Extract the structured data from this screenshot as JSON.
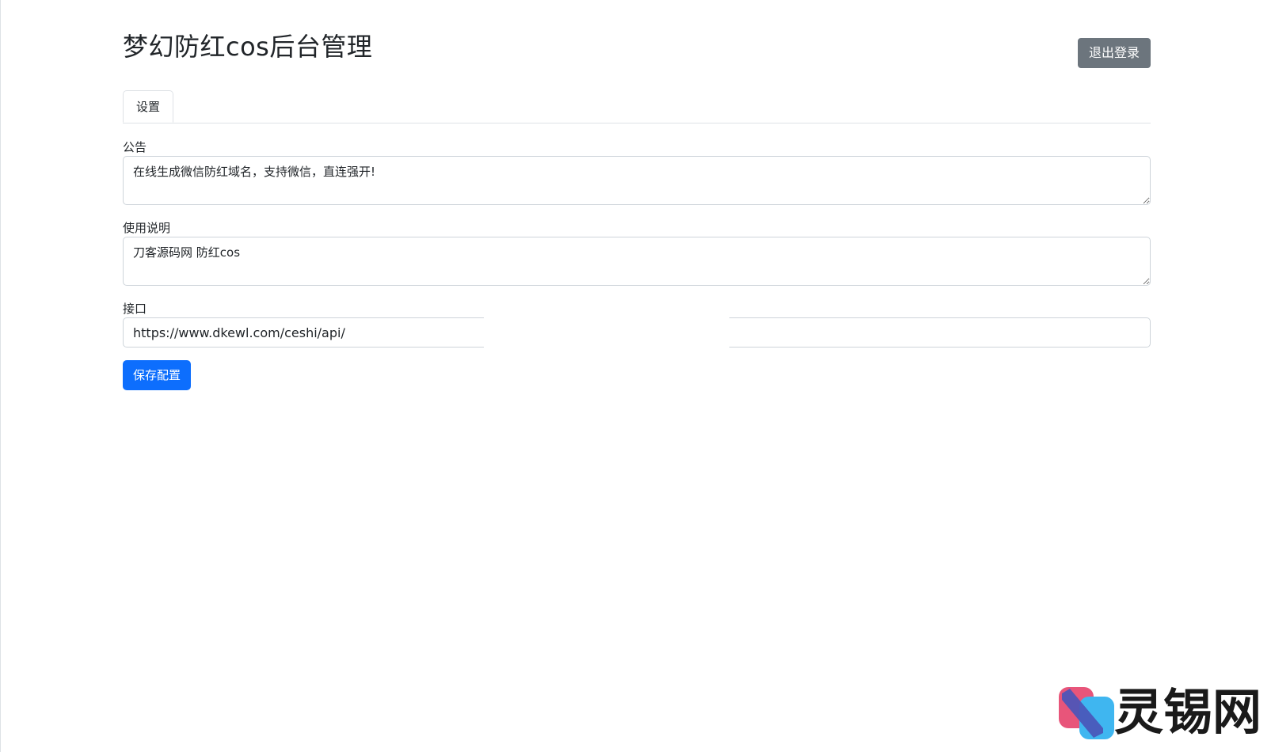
{
  "header": {
    "title": "梦幻防红cos后台管理",
    "logout_label": "退出登录"
  },
  "tabs": [
    {
      "label": "设置",
      "active": true
    }
  ],
  "form": {
    "notice": {
      "label": "公告",
      "value": "在线生成微信防红域名，支持微信，直连强开!"
    },
    "instructions": {
      "label": "使用说明",
      "value": "刀客源码网 防红cos"
    },
    "api": {
      "label": "接口",
      "value": "https://www.dkewl.com/ceshi/api/"
    },
    "save_label": "保存配置"
  },
  "watermark": {
    "text": "灵锡网"
  },
  "colors": {
    "primary": "#0d6efd",
    "secondary": "#6c757d",
    "border": "#dee2e6",
    "input_border": "#ced4da",
    "watermark_pink": "#e8557a",
    "watermark_blue": "#3fb6f0",
    "watermark_indigo": "#4a56b8"
  }
}
